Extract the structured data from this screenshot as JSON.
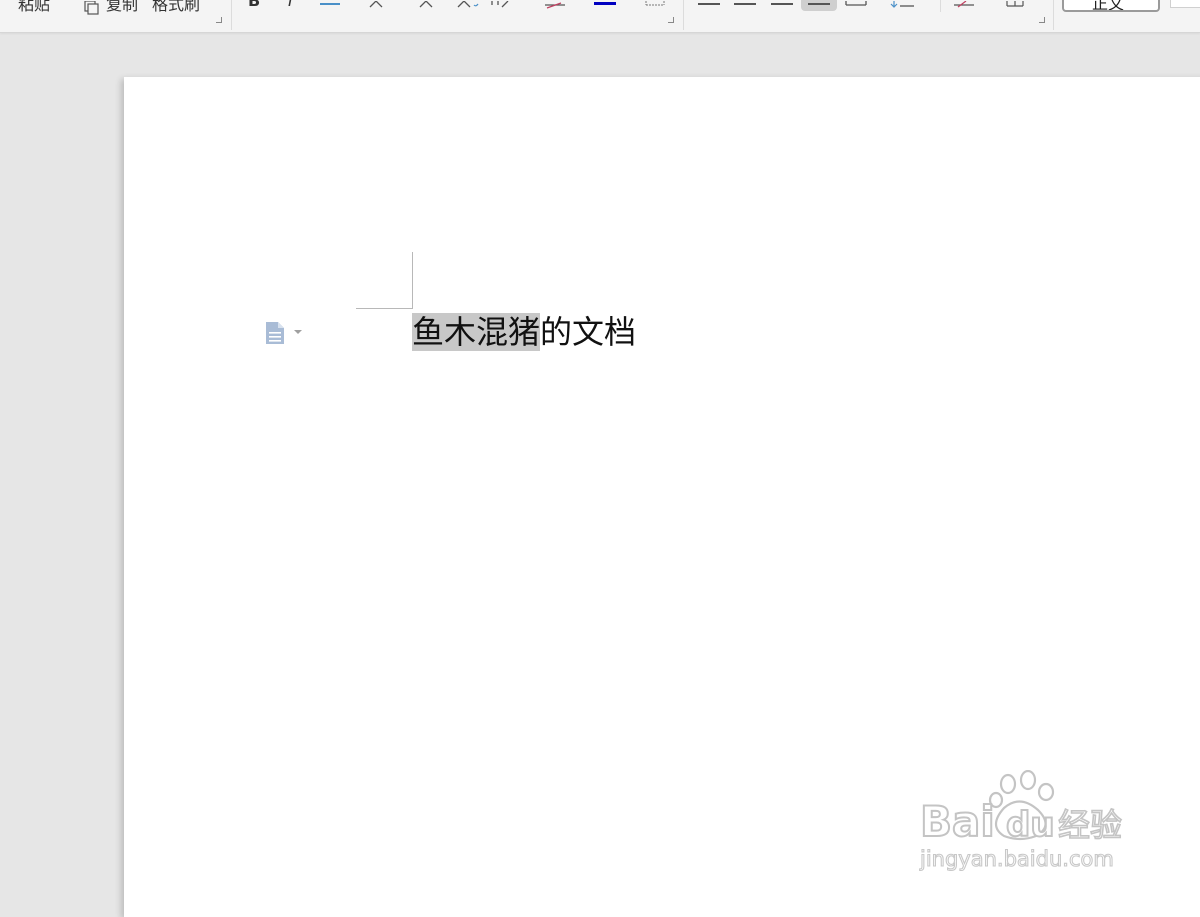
{
  "ribbon": {
    "paste_label": "粘贴",
    "copy_label": "复制",
    "format_painter_label": "格式刷",
    "bold_label": "B",
    "italic_label": "I",
    "style_label": "正文"
  },
  "document": {
    "selected_text": "鱼木混猪",
    "rest_text": "的文档"
  },
  "watermark": {
    "brand_text": "Bai",
    "brand_text2": "du",
    "brand_cn": "经验",
    "url": "jingyan.baidu.com"
  },
  "colors": {
    "page_bg": "#e6e6e6",
    "selection": "#c8c8c8",
    "font_color_underline": "#0000c0"
  }
}
